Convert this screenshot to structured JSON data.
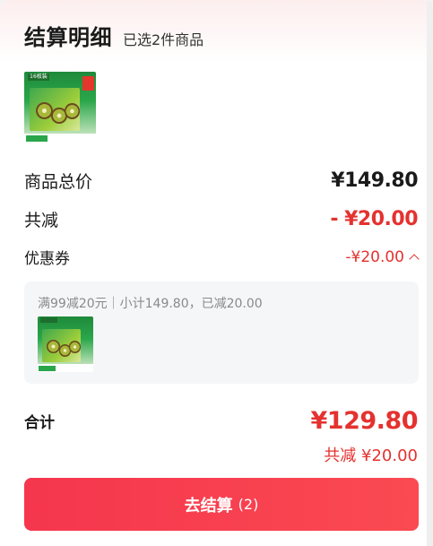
{
  "header": {
    "title": "结算明细",
    "subtitle": "已选2件商品"
  },
  "product": {
    "tag_text": "16枚装",
    "image_label": "kiwi-gift-box"
  },
  "summary": {
    "total_label": "商品总价",
    "total_value": "¥149.80",
    "reduce_label": "共减",
    "reduce_value": "- ¥20.00",
    "coupon_label": "优惠券",
    "coupon_value": "-¥20.00"
  },
  "coupon_detail": {
    "text": "满99减20元｜小计149.80，已减20.00"
  },
  "totals": {
    "sum_label": "合计",
    "sum_value": "¥129.80",
    "saved_text": "共减 ¥20.00"
  },
  "checkout": {
    "label": "去结算",
    "count": "(2)"
  },
  "colors": {
    "accent": "#e4322f",
    "button": "#f5364d"
  }
}
